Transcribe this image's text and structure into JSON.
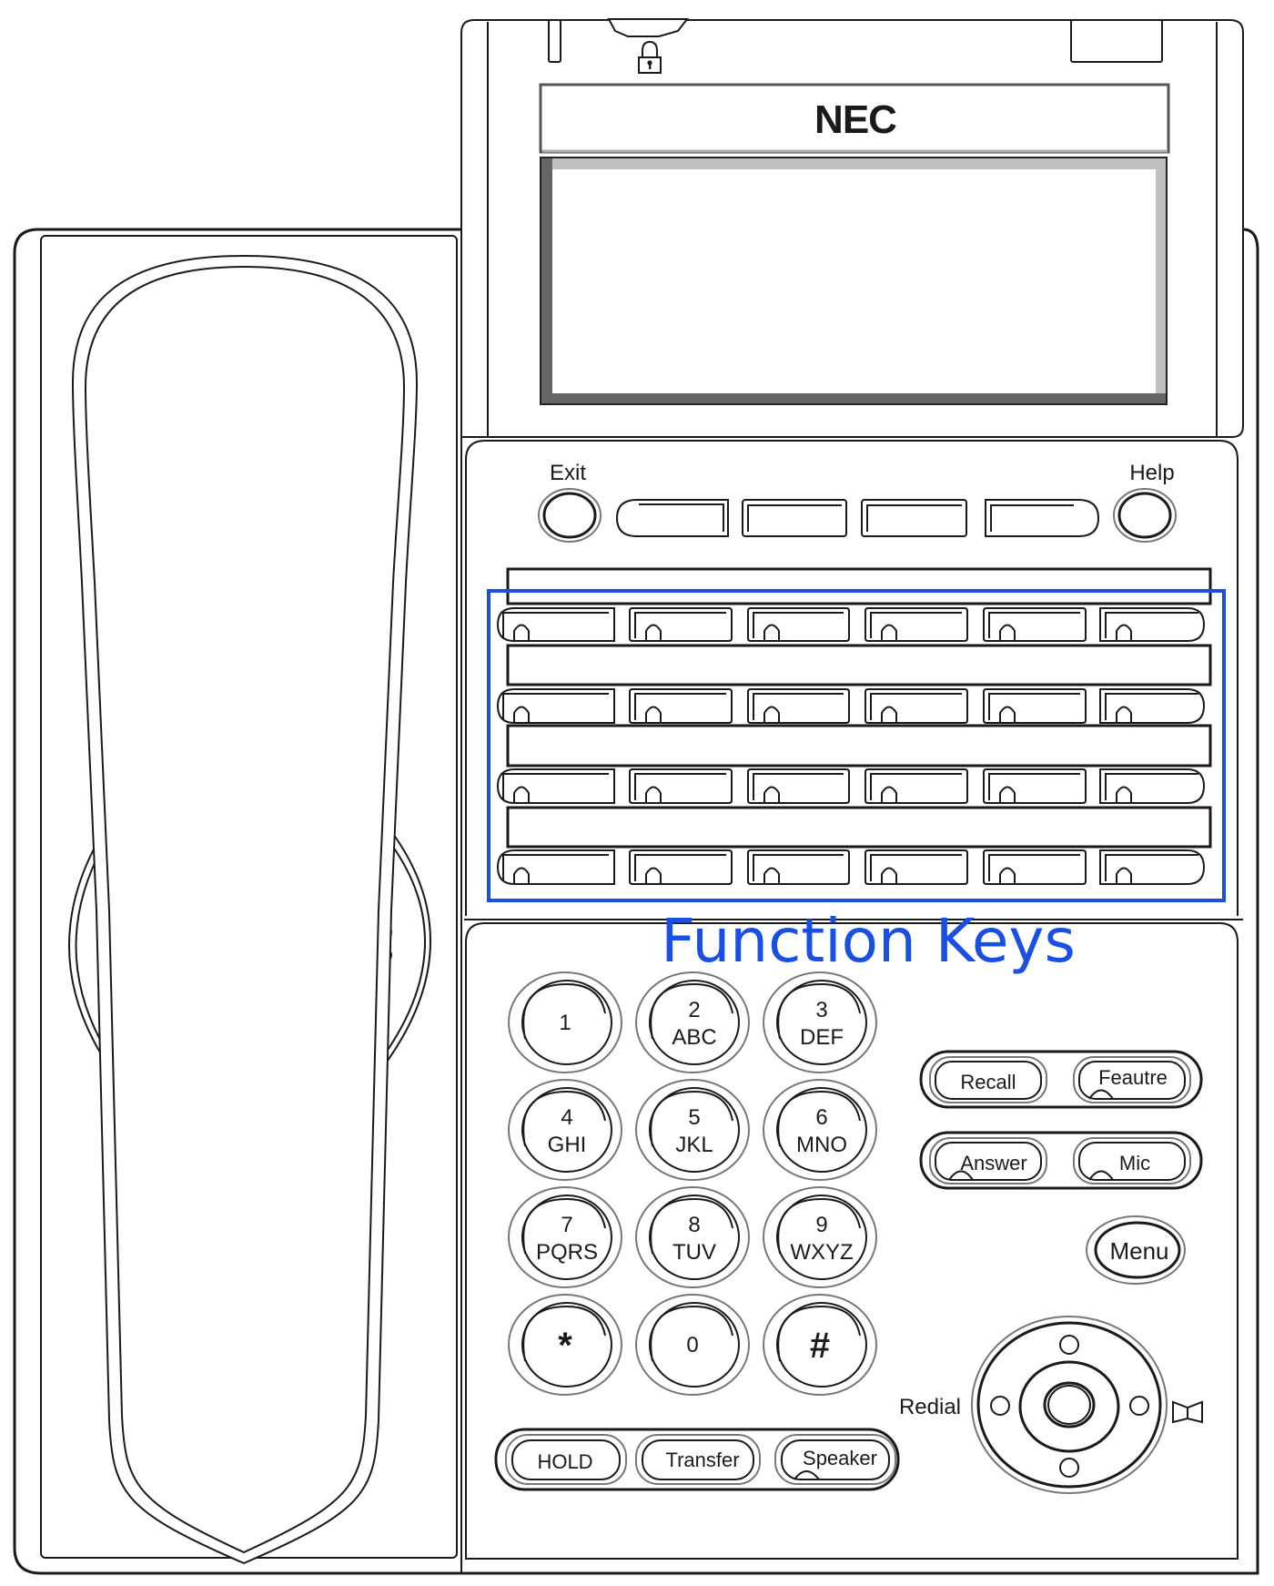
{
  "device": {
    "brand": "NEC",
    "type": "desk-telephone-diagram"
  },
  "top": {
    "lock_icon": "lock-icon"
  },
  "softkeys": {
    "exit_label": "Exit",
    "help_label": "Help",
    "count": 4
  },
  "function_keys": {
    "callout_label": "Function Keys",
    "callout_color": "#1a4fe6",
    "rows": 4,
    "columns": 6
  },
  "keypad": {
    "keys": [
      {
        "digit": "1",
        "letters": ""
      },
      {
        "digit": "2",
        "letters": "ABC"
      },
      {
        "digit": "3",
        "letters": "DEF"
      },
      {
        "digit": "4",
        "letters": "GHI"
      },
      {
        "digit": "5",
        "letters": "JKL"
      },
      {
        "digit": "6",
        "letters": "MNO"
      },
      {
        "digit": "7",
        "letters": "PQRS"
      },
      {
        "digit": "8",
        "letters": "TUV"
      },
      {
        "digit": "9",
        "letters": "WXYZ"
      },
      {
        "digit": "*",
        "letters": ""
      },
      {
        "digit": "0",
        "letters": ""
      },
      {
        "digit": "#",
        "letters": ""
      }
    ]
  },
  "right_keys": {
    "recall": "Recall",
    "feature": "Feautre",
    "answer": "Answer",
    "mic": "Mic",
    "menu": "Menu",
    "redial": "Redial",
    "directory_icon": "book-icon"
  },
  "bottom_keys": {
    "hold": "HOLD",
    "transfer": "Transfer",
    "speaker": "Speaker"
  }
}
